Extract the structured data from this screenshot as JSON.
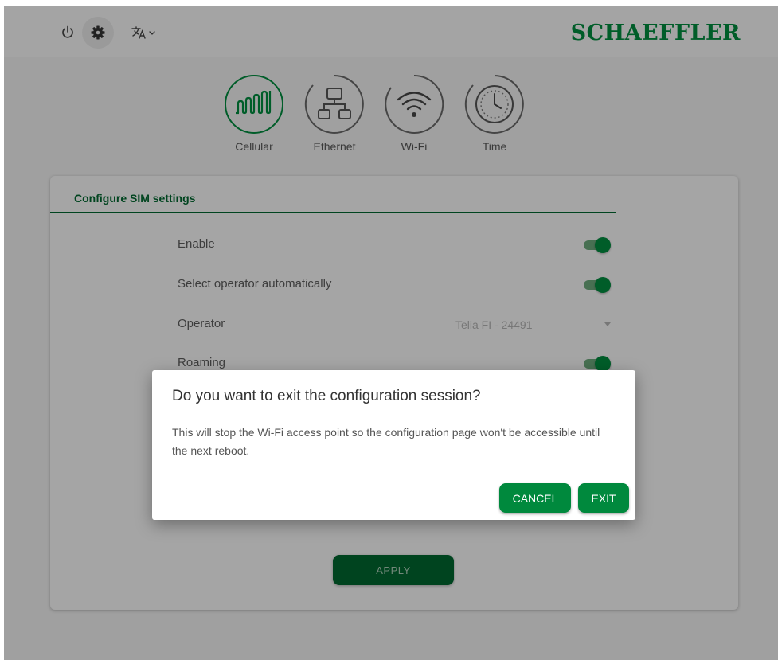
{
  "header": {
    "logo": "SCHAEFFLER",
    "power_icon": "power-icon",
    "settings_icon": "gear-icon",
    "language_icon": "translate-icon"
  },
  "nav": {
    "items": [
      {
        "label": "Cellular",
        "icon": "cellular-signal-icon",
        "active": true
      },
      {
        "label": "Ethernet",
        "icon": "network-icon",
        "active": false
      },
      {
        "label": "Wi-Fi",
        "icon": "wifi-icon",
        "active": false
      },
      {
        "label": "Time",
        "icon": "clock-icon",
        "active": false
      }
    ]
  },
  "card": {
    "title": "Configure SIM settings",
    "rows": [
      {
        "label": "Enable",
        "type": "toggle",
        "on": true
      },
      {
        "label": "Select operator automatically",
        "type": "toggle",
        "on": true
      },
      {
        "label": "Operator",
        "type": "select",
        "value": "Telia FI - 24491"
      },
      {
        "label": "Roaming",
        "type": "toggle",
        "on": true
      }
    ],
    "apply_label": "APPLY"
  },
  "dialog": {
    "title": "Do you want to exit the configuration session?",
    "text": "This will stop the Wi-Fi access point so the configuration page won't be accessible until the next reboot.",
    "cancel_label": "CANCEL",
    "exit_label": "EXIT"
  },
  "colors": {
    "brand": "#00893d",
    "brand_dark": "#00652e"
  }
}
